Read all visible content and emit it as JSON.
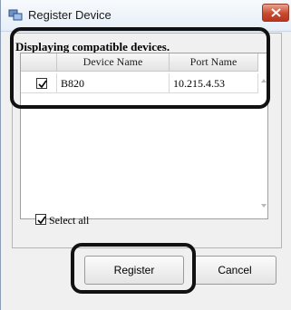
{
  "window": {
    "title": "Register Device",
    "app_icon": "register-device-app-icon",
    "close_icon": "close-icon"
  },
  "main": {
    "heading": "Displaying compatible devices.",
    "table": {
      "columns": [
        "",
        "Device Name",
        "Port Name"
      ],
      "rows": [
        {
          "checked": true,
          "device_name": "B820",
          "port_name": "10.215.4.53"
        }
      ]
    },
    "select_all": {
      "label": "Select all",
      "checked": true
    }
  },
  "buttons": {
    "register": "Register",
    "cancel": "Cancel"
  },
  "colors": {
    "highlight": "#111111",
    "close_button": "#c8492f"
  }
}
